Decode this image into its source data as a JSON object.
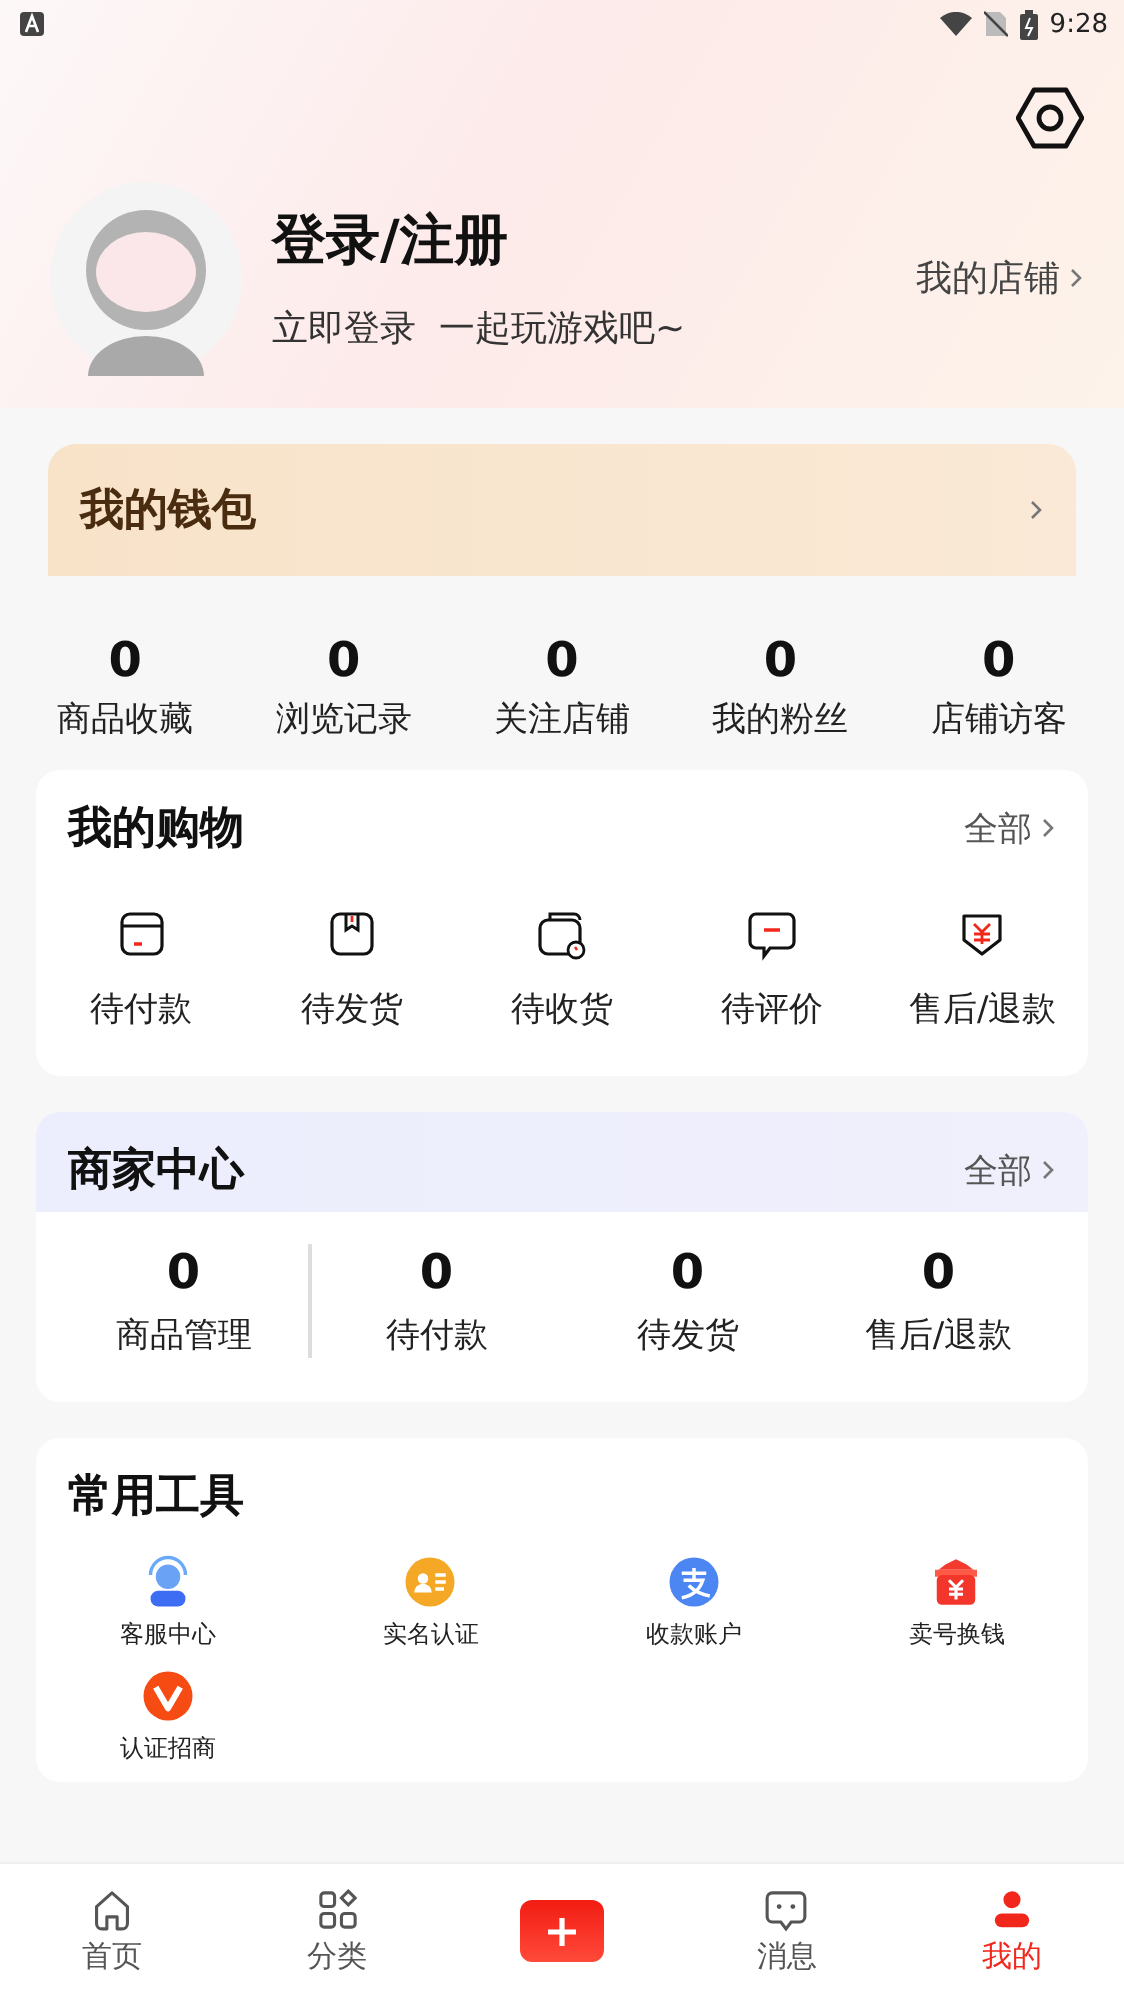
{
  "status_bar": {
    "time": "9:28"
  },
  "profile": {
    "title": "登录/注册",
    "subtitle": "立即登录  一起玩游戏吧~",
    "shop_link": "我的店铺"
  },
  "wallet": {
    "title": "我的钱包"
  },
  "stats": [
    {
      "value": "0",
      "label": "商品收藏"
    },
    {
      "value": "0",
      "label": "浏览记录"
    },
    {
      "value": "0",
      "label": "关注店铺"
    },
    {
      "value": "0",
      "label": "我的粉丝"
    },
    {
      "value": "0",
      "label": "店铺访客"
    }
  ],
  "shopping": {
    "title": "我的购物",
    "more": "全部",
    "items": [
      {
        "label": "待付款"
      },
      {
        "label": "待发货"
      },
      {
        "label": "待收货"
      },
      {
        "label": "待评价"
      },
      {
        "label": "售后/退款"
      }
    ]
  },
  "merchant": {
    "title": "商家中心",
    "more": "全部",
    "stats": [
      {
        "value": "0",
        "label": "商品管理"
      },
      {
        "value": "0",
        "label": "待付款"
      },
      {
        "value": "0",
        "label": "待发货"
      },
      {
        "value": "0",
        "label": "售后/退款"
      }
    ]
  },
  "tools": {
    "title": "常用工具",
    "items": [
      {
        "label": "客服中心"
      },
      {
        "label": "实名认证"
      },
      {
        "label": "收款账户"
      },
      {
        "label": "卖号换钱"
      },
      {
        "label": "认证招商"
      }
    ]
  },
  "tab_bar": [
    {
      "kind": "tab",
      "label": "首页",
      "selected": false
    },
    {
      "kind": "tab",
      "label": "分类",
      "selected": false
    },
    {
      "kind": "publish",
      "selected": false
    },
    {
      "kind": "tab",
      "label": "消息",
      "selected": false
    },
    {
      "kind": "tab",
      "label": "我的",
      "selected": true
    }
  ]
}
